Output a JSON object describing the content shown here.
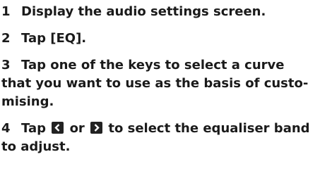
{
  "steps": [
    {
      "number": "1",
      "lines": [
        "Display the audio settings screen."
      ]
    },
    {
      "number": "2",
      "lines": [
        "Tap [EQ]."
      ]
    },
    {
      "number": "3",
      "lines": [
        "Tap one of the keys to select a curve",
        "that you want to use as the basis of custo-",
        "mising."
      ]
    },
    {
      "number": "4",
      "line1_pre": "Tap",
      "line1_mid": "or",
      "line1_post": "to select the equaliser band",
      "line2": "to adjust.",
      "icons": [
        "left-arrow-key-icon",
        "right-arrow-key-icon"
      ]
    }
  ],
  "colors": {
    "text": "#1a1a1a",
    "key_background": "#222222",
    "key_glyph": "#ffffff"
  }
}
